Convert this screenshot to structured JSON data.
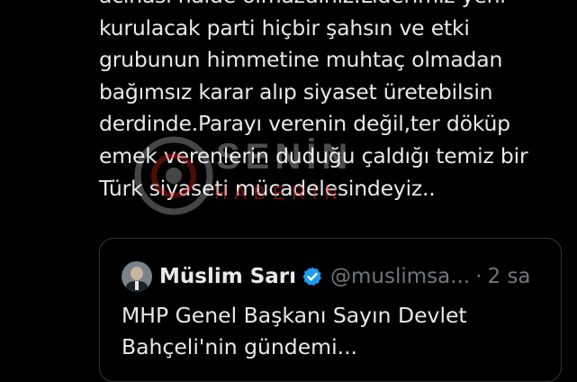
{
  "tweet": {
    "text": "acınası halde olmazdınız.Liderimiz yeni\nkurulacak parti hiçbir şahsın ve etki\ngrubunun himmetine muhtaç olmadan\nbağımsız karar alıp siyaset üretebilsin\nderdinde.Parayı verenin değil,ter döküp\nemek verenlerin duduğu çaldığı temiz bir\nTürk siyaseti mücadelesindeyiz.."
  },
  "quote": {
    "name": "Müslim Sarı",
    "handle": "@muslimsa...",
    "dot": "·",
    "time": "2 sa",
    "text": "MHP Genel Başkanı Sayın Devlet\nBahçeli'nin gündemi..."
  },
  "watermark": {
    "brand": "SENİN",
    "sub": "HABERİN"
  },
  "colors": {
    "background": "#000000",
    "text": "#e7e9ea",
    "muted": "#71767b",
    "verified": "#1d9bf0",
    "card_border": "#2f3336"
  }
}
